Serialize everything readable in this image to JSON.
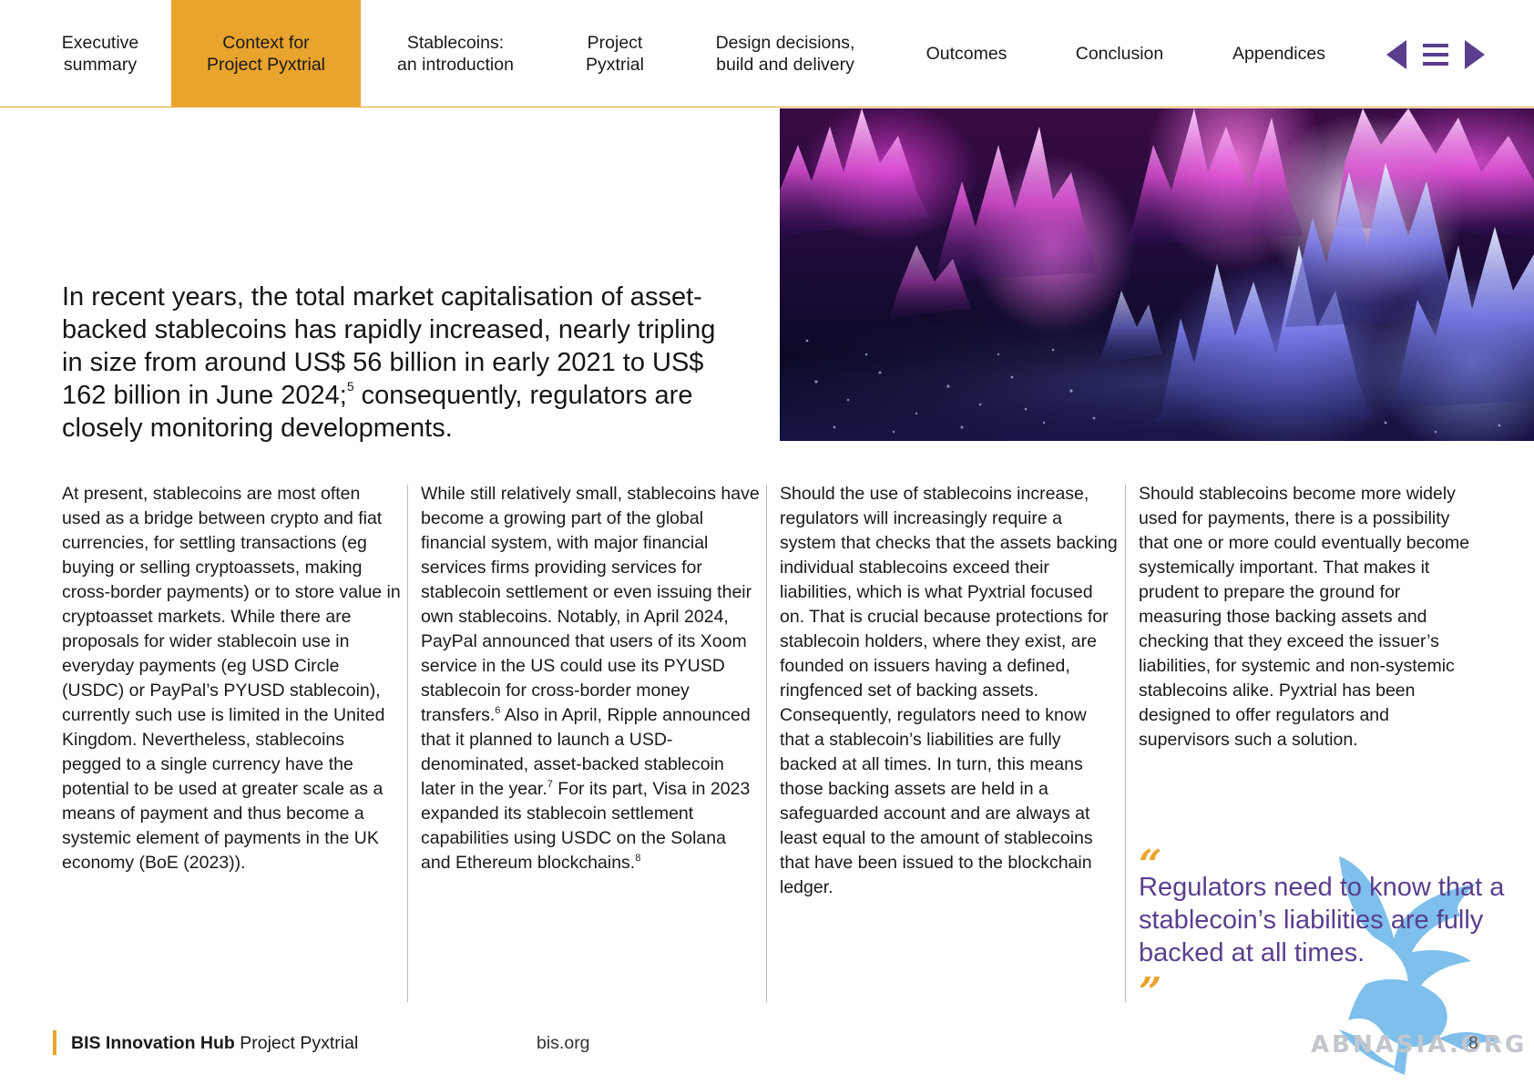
{
  "nav": {
    "tabs": [
      {
        "label": "Executive\nsummary"
      },
      {
        "label": "Context for\nProject Pyxtrial",
        "active": true
      },
      {
        "label": "Stablecoins:\nan introduction"
      },
      {
        "label": "Project\nPyxtrial"
      },
      {
        "label": "Design decisions,\nbuild and delivery"
      },
      {
        "label": "Outcomes"
      },
      {
        "label": "Conclusion"
      },
      {
        "label": "Appendices"
      }
    ],
    "icons": [
      "previous-page-icon",
      "menu-icon",
      "next-page-icon"
    ],
    "accent_color": "#e9a42d",
    "icon_color": "#5a3e8e"
  },
  "lead": {
    "text": "In recent years, the total market capitalisation of asset-backed stablecoins has rapidly increased, nearly tripling in size from around US$ 56 billion in early 2021 to US$ 162 billion in June 2024;",
    "footnote": "5",
    "text_end": " consequently, regulators are closely monitoring developments."
  },
  "columns": {
    "col1": {
      "text": "At present, stablecoins are most often used as a bridge between crypto and fiat currencies, for settling transactions (eg buying or selling cryptoassets, making cross-border payments) or to store value in cryptoasset markets. While there are proposals for wider stablecoin use in everyday payments (eg USD Circle (USDC) or PayPal’s PYUSD stablecoin), currently such use is limited in the United Kingdom. Nevertheless, stablecoins pegged to a single currency have the potential to be used at greater scale as a means of payment and thus become a systemic element of payments in the UK economy (BoE (2023))."
    },
    "col2": {
      "part1": "While still relatively small, stablecoins have become a growing part of the global financial system, with major financial services firms providing services for stablecoin settlement or even issuing their own stablecoins. Notably, in April 2024, PayPal announced that users of its Xoom service in the US could use its PYUSD stablecoin for cross-border money transfers.",
      "fn1": "6",
      "part2": " Also in April, Ripple announced that it planned to launch a USD-denominated, asset-backed stablecoin later in the year.",
      "fn2": "7",
      "part3": " For its part, Visa in 2023 expanded its stablecoin settlement capabilities using USDC on the Solana and Ethereum blockchains.",
      "fn3": "8"
    },
    "col3": {
      "text": "Should the use of stablecoins increase, regulators will increasingly require a system that checks that the assets backing individual stablecoins exceed their liabilities, which is what Pyxtrial focused on. That is crucial because protections for stablecoin holders, where they exist, are founded on issuers having a defined, ringfenced set of backing assets. Consequently, regulators need to know that a stablecoin’s liabilities are fully backed at all times. In turn, this means those backing assets are held in a safeguarded account and are always at least equal to the amount of stablecoins that have been issued to the blockchain ledger."
    },
    "col4": {
      "text": "Should stablecoins become more widely used for payments, there is a possibility that one or more could eventually become systemically important. That makes it prudent to prepare the ground for measuring those backing assets and checking that they exceed the issuer’s liabilities, for systemic and non-systemic stablecoins alike. Pyxtrial has been designed to offer regulators and supervisors such a solution."
    }
  },
  "quote": {
    "open": "“",
    "text": "Regulators need to know that a stablecoin’s liabilities are fully backed at all times.",
    "close": "”",
    "color": "#5a3e8e"
  },
  "footer": {
    "brand_bold": "BIS Innovation Hub",
    "brand_rest": " Project Pyxtrial",
    "link": "bis.org",
    "page": "8",
    "watermark_text": "ABNASIA.ORG"
  }
}
